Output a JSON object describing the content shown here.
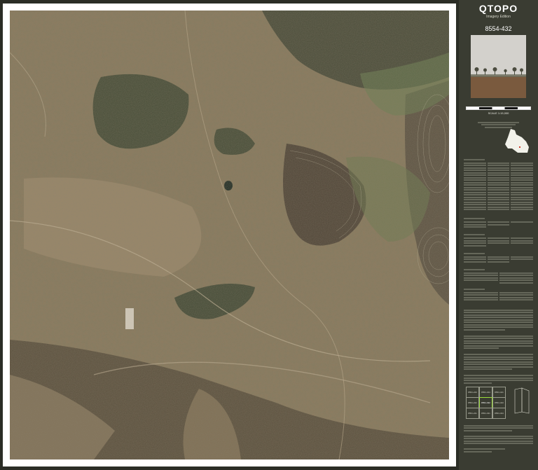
{
  "header": {
    "title": "QTOPO",
    "subtitle": "Imagery Edition"
  },
  "sheet": {
    "number": "8554-432"
  },
  "scale": {
    "label": "SCALE 1:15,000"
  },
  "index": {
    "cells": [
      {
        "id": "8554-243"
      },
      {
        "id": "8554-344"
      },
      {
        "id": "8554-441"
      },
      {
        "id": "8554-242"
      },
      {
        "id": "8554-432"
      },
      {
        "id": "8554-433"
      },
      {
        "id": "8554-241"
      },
      {
        "id": "8554-431"
      },
      {
        "id": "8554-434"
      }
    ]
  },
  "colors": {
    "panel": "#3a3c32",
    "frame": "#ffffff",
    "active_index": "#9bdd3c"
  }
}
